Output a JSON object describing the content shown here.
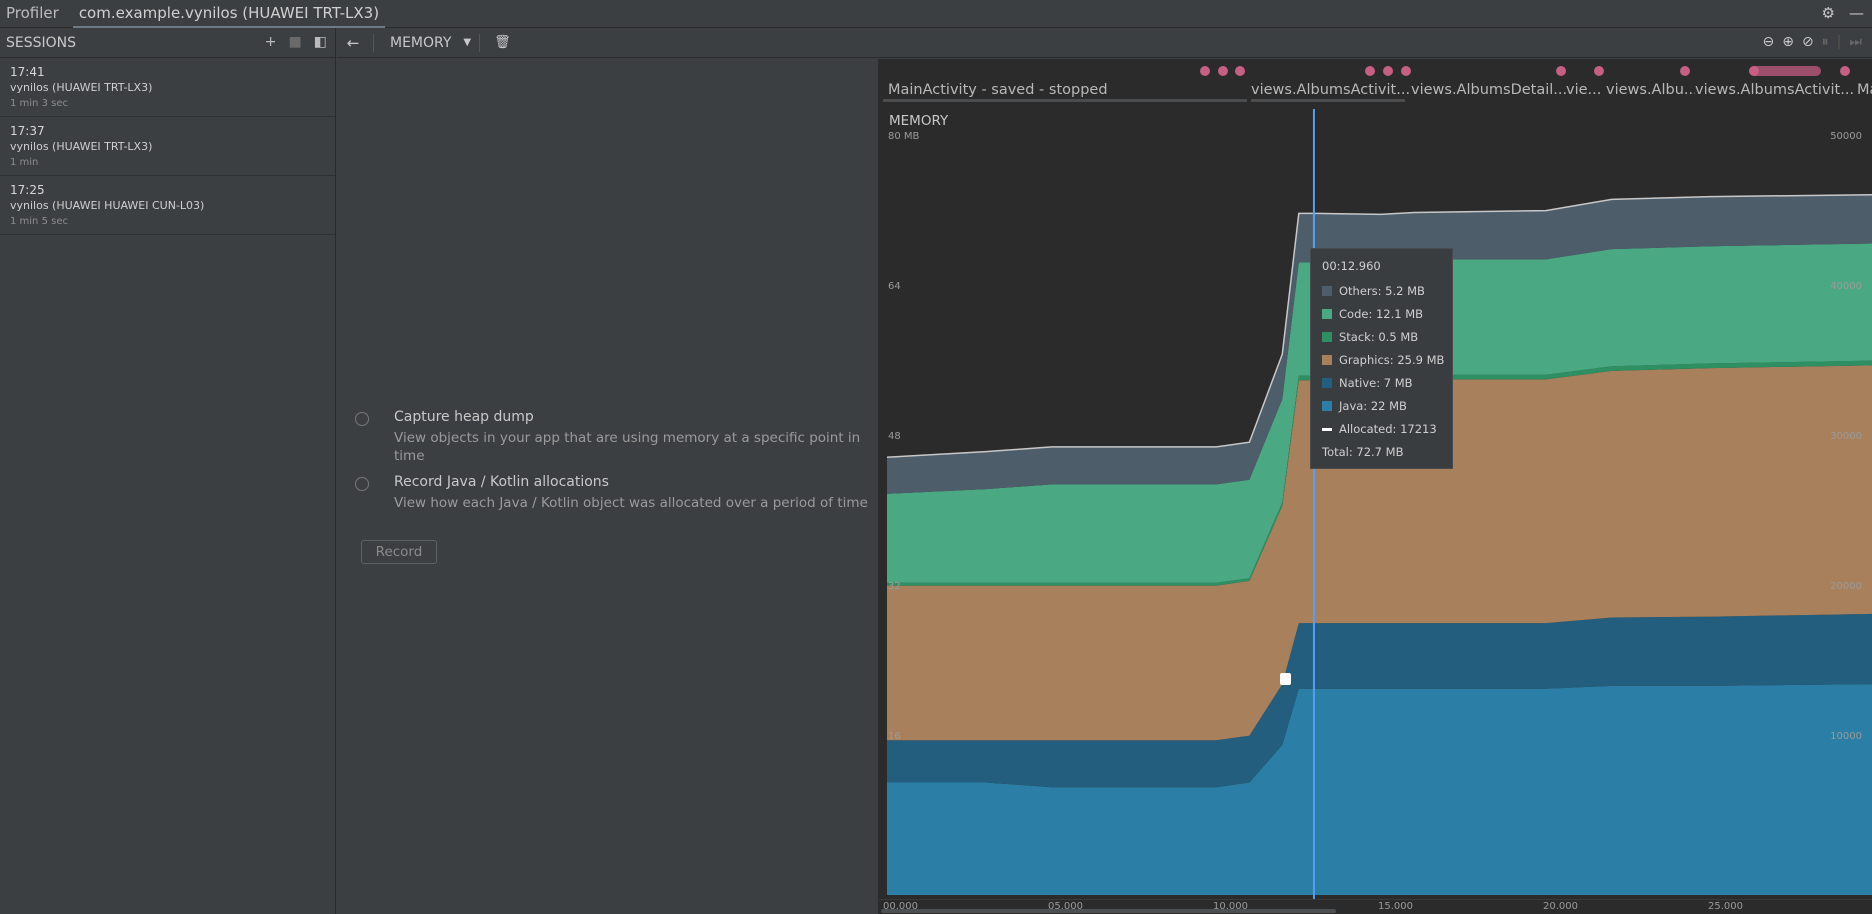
{
  "titlebar": {
    "tabs": [
      "Profiler",
      "com.example.vynilos (HUAWEI TRT-LX3)"
    ],
    "icons": [
      "gear-icon",
      "minimize-icon"
    ]
  },
  "sessions": {
    "header": "SESSIONS",
    "items": [
      {
        "time": "17:41",
        "device": "vynilos (HUAWEI TRT-LX3)",
        "duration": "1 min 3 sec"
      },
      {
        "time": "17:37",
        "device": "vynilos (HUAWEI TRT-LX3)",
        "duration": "1 min"
      },
      {
        "time": "17:25",
        "device": "vynilos (HUAWEI HUAWEI CUN-L03)",
        "duration": "1 min 5 sec"
      }
    ]
  },
  "toolbar": {
    "profiler": "MEMORY"
  },
  "capture": {
    "options": [
      {
        "title": "Capture heap dump",
        "description": "View objects in your app that are using memory at a specific point in time"
      },
      {
        "title": "Record Java / Kotlin allocations",
        "description": "View how each Java / Kotlin object was allocated over a period of time"
      }
    ],
    "record_label": "Record"
  },
  "states": [
    "MainActivity - saved - stopped",
    "views.AlbumsActivit...",
    "views.AlbumsDetail...",
    "vie...",
    "views.Albu...",
    "views.AlbumsActivit...",
    "Ma"
  ],
  "memory": {
    "title": "MEMORY",
    "left_ticks": [
      "80 MB",
      "64",
      "48",
      "32",
      "16"
    ],
    "right_ticks": [
      "50000",
      "40000",
      "30000",
      "20000",
      "10000"
    ],
    "x_ticks": [
      "00.000",
      "05.000",
      "10.000",
      "15.000",
      "20.000",
      "25.000"
    ]
  },
  "tooltip": {
    "timestamp": "00:12.960",
    "rows": [
      {
        "label": "Others: 5.2 MB",
        "color": "#4e5d6a"
      },
      {
        "label": "Code: 12.1 MB",
        "color": "#4aa883"
      },
      {
        "label": "Stack: 0.5 MB",
        "color": "#2e8f62"
      },
      {
        "label": "Graphics: 25.9 MB",
        "color": "#a9805c"
      },
      {
        "label": "Native: 7 MB",
        "color": "#245e7e"
      },
      {
        "label": "Java: 22 MB",
        "color": "#2b7ea5"
      },
      {
        "label": "Allocated: 17213",
        "color": "#ffffff"
      },
      {
        "label": "Total: 72.7 MB",
        "color": ""
      }
    ]
  },
  "chart_data": {
    "type": "area",
    "title": "MEMORY",
    "xlabel": "",
    "ylabel": "",
    "x": [
      0,
      3,
      5,
      10,
      11,
      12,
      12.5,
      13,
      15,
      16,
      20,
      22,
      25,
      30
    ],
    "ylim": [
      0,
      80
    ],
    "y2lim": [
      0,
      50000
    ],
    "series": [
      {
        "name": "Java",
        "values": [
          12,
          12,
          11.5,
          11.5,
          12,
          16,
          22,
          22,
          22,
          22,
          22,
          22.3,
          22.3,
          22.5
        ]
      },
      {
        "name": "Native",
        "values": [
          4.5,
          4.5,
          5,
          5,
          5,
          6.5,
          7,
          7,
          7,
          7,
          7,
          7.3,
          7.4,
          7.5
        ]
      },
      {
        "name": "Graphics",
        "values": [
          16.5,
          16.5,
          16.5,
          16.5,
          16.5,
          19,
          25.9,
          25.9,
          25.9,
          26,
          26,
          26.3,
          26.5,
          26.5
        ]
      },
      {
        "name": "Stack",
        "values": [
          0.3,
          0.3,
          0.3,
          0.3,
          0.3,
          0.4,
          0.5,
          0.5,
          0.5,
          0.5,
          0.5,
          0.5,
          0.5,
          0.5
        ]
      },
      {
        "name": "Code",
        "values": [
          9.5,
          10,
          10.5,
          10.5,
          10.5,
          11,
          12.1,
          12.1,
          12.2,
          12.3,
          12.3,
          12.5,
          12.5,
          12.5
        ]
      },
      {
        "name": "Others",
        "values": [
          3.9,
          4,
          4,
          4,
          4,
          4.8,
          5.2,
          5.2,
          5,
          5,
          5.2,
          5.3,
          5.3,
          5.2
        ]
      }
    ],
    "cursor_x": 12.96,
    "grid": false
  }
}
